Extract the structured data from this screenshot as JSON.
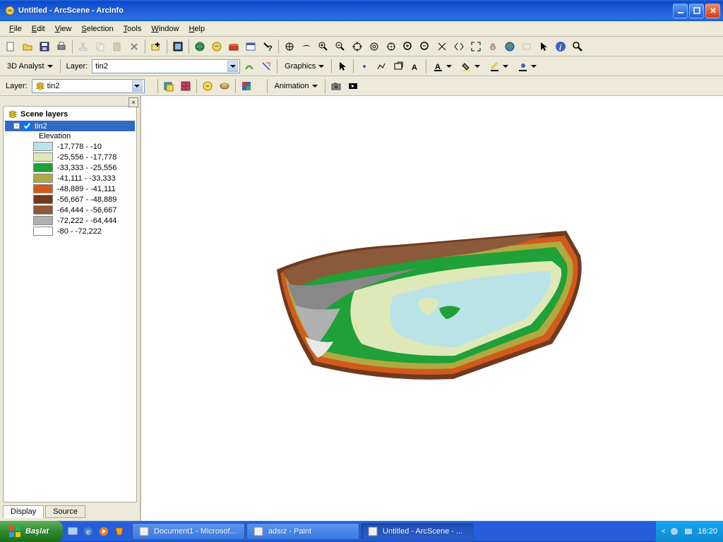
{
  "window": {
    "title": "Untitled - ArcScene - ArcInfo"
  },
  "menu": [
    "File",
    "Edit",
    "View",
    "Selection",
    "Tools",
    "Window",
    "Help"
  ],
  "toolbar3": {
    "analyst_label": "3D Analyst",
    "layer_label": "Layer:",
    "layer_value": "tin2",
    "graphics_label": "Graphics"
  },
  "toolbar4": {
    "layer_label": "Layer:",
    "layer_value": "tin2",
    "animation_label": "Animation"
  },
  "toc": {
    "title": "Scene layers",
    "layer_name": "tin2",
    "classification": "Elevation",
    "legend": [
      {
        "color": "#b9e3e6",
        "label": "-17,778 - -10"
      },
      {
        "color": "#dfe9b8",
        "label": "-25,556 - -17,778"
      },
      {
        "color": "#1fa038",
        "label": "-33,333 - -25,556"
      },
      {
        "color": "#b0a93f",
        "label": "-41,111 - -33,333"
      },
      {
        "color": "#d25a1b",
        "label": "-48,889 - -41,111"
      },
      {
        "color": "#6e3a20",
        "label": "-56,667 - -48,889"
      },
      {
        "color": "#8a5a3a",
        "label": "-64,444 - -56,667"
      },
      {
        "color": "#b0b0b0",
        "label": "-72,222 - -64,444"
      },
      {
        "color": "#ffffff",
        "label": "-80 - -72,222"
      }
    ],
    "tabs": {
      "display": "Display",
      "source": "Source"
    }
  },
  "taskbar": {
    "start": "Başlat",
    "items": [
      {
        "label": "Document1 - Microsof...",
        "active": false
      },
      {
        "label": "adsız - Paint",
        "active": false
      },
      {
        "label": "Untitled - ArcScene - ...",
        "active": true
      }
    ],
    "clock": "16:20"
  }
}
